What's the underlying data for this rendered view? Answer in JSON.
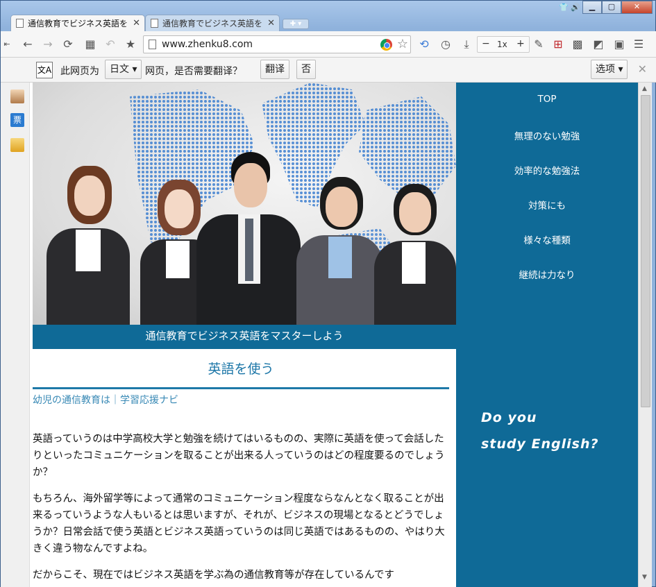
{
  "tabs": [
    {
      "label": "通信教育でビジネス英語を",
      "active": true
    },
    {
      "label": "通信教育でビジネス英語を",
      "active": false
    }
  ],
  "address": {
    "url": "www.zhenku8.com"
  },
  "zoom": {
    "minus": "−",
    "level": "1x",
    "plus": "+"
  },
  "translate_bar": {
    "prefix": "此网页为",
    "language": "日文",
    "suffix": "网页，是否需要翻译？",
    "translate_button": "翻译",
    "no_button": "否",
    "options_button": "选项",
    "icon_text": "文A"
  },
  "sidebar": {
    "ticket_icon_text": "票"
  },
  "hero": {
    "caption": "通信教育でビジネス英語をマスターしよう"
  },
  "article": {
    "title": "英語を使う",
    "subtitle": "幼児の通信教育は｜学習応援ナビ",
    "paragraphs": [
      "英語っていうのは中学高校大学と勉強を続けてはいるものの、実際に英語を使って会話したりといったコミュニケーションを取ることが出来る人っていうのはどの程度要るのでしょうか？",
      "もちろん、海外留学等によって通常のコミュニケーション程度ならなんとなく取ることが出来るっていうような人もいるとは思いますが、それが、ビジネスの現場となるとどうでしょうか？日常会話で使う英語とビジネス英語っていうのは同じ英語ではあるものの、やはり大きく違う物なんですよね。",
      "だからこそ、現在ではビジネス英語を学ぶ為の通信教育等が存在しているんです"
    ]
  },
  "nav": [
    "TOP",
    "無理のない勉強",
    "効率的な勉強法",
    "対策にも",
    "様々な種類",
    "継続は力なり"
  ],
  "promo": {
    "line1": "Do you",
    "line2": "study English?"
  },
  "colors": {
    "accent": "#0f6a97",
    "title": "#1d77a8"
  }
}
